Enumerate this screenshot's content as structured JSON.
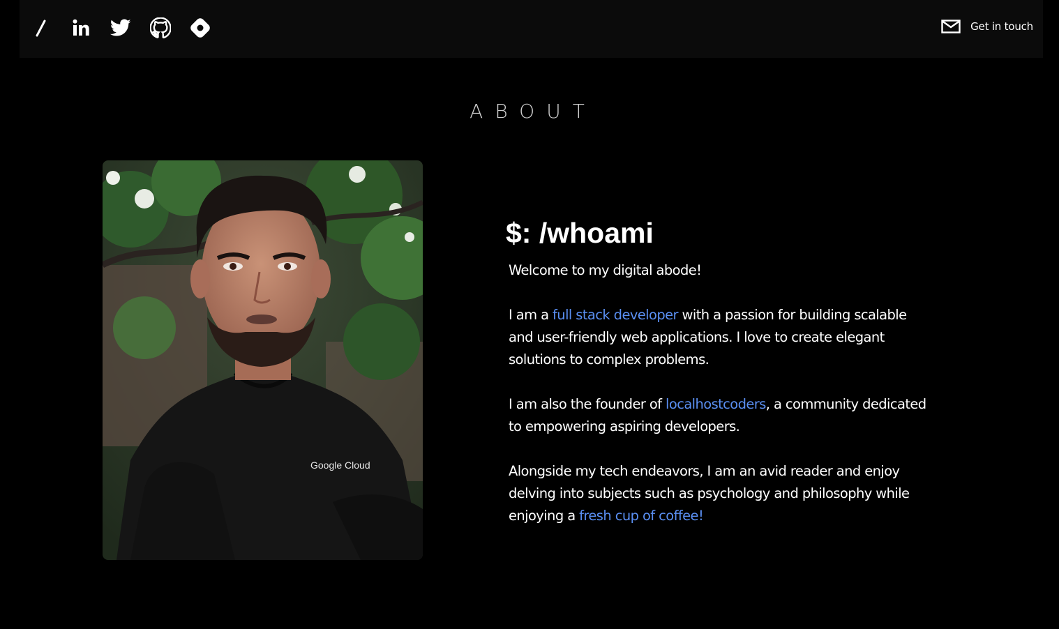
{
  "nav": {
    "icons": [
      "slash-logo-icon",
      "linkedin-icon",
      "twitter-icon",
      "github-icon",
      "hashnode-icon"
    ],
    "contact_label": "Get in touch",
    "contact_icon": "mail-icon"
  },
  "about": {
    "title": "ABOUT",
    "heading": "$: /whoami",
    "welcome": "Welcome to my digital abode!",
    "p1_pre": "I am a ",
    "p1_link": "full stack developer",
    "p1_post": " with a passion for building scalable and user-friendly web applications. I love to create elegant solutions to complex problems.",
    "p2_pre": "I am also the founder of ",
    "p2_link": "localhostcoders",
    "p2_post": ", a community dedicated to empowering aspiring developers.",
    "p3_pre": "Alongside my tech endeavors, I am an avid reader and enjoy delving into subjects such as psychology and philosophy while enjoying a ",
    "p3_link": "fresh cup of coffee!",
    "shirt_logo": "Google Cloud"
  },
  "colors": {
    "background": "#000000",
    "navbar": "#0b0b0b",
    "link": "#5a8ff2",
    "title": "#cfcfcf"
  }
}
